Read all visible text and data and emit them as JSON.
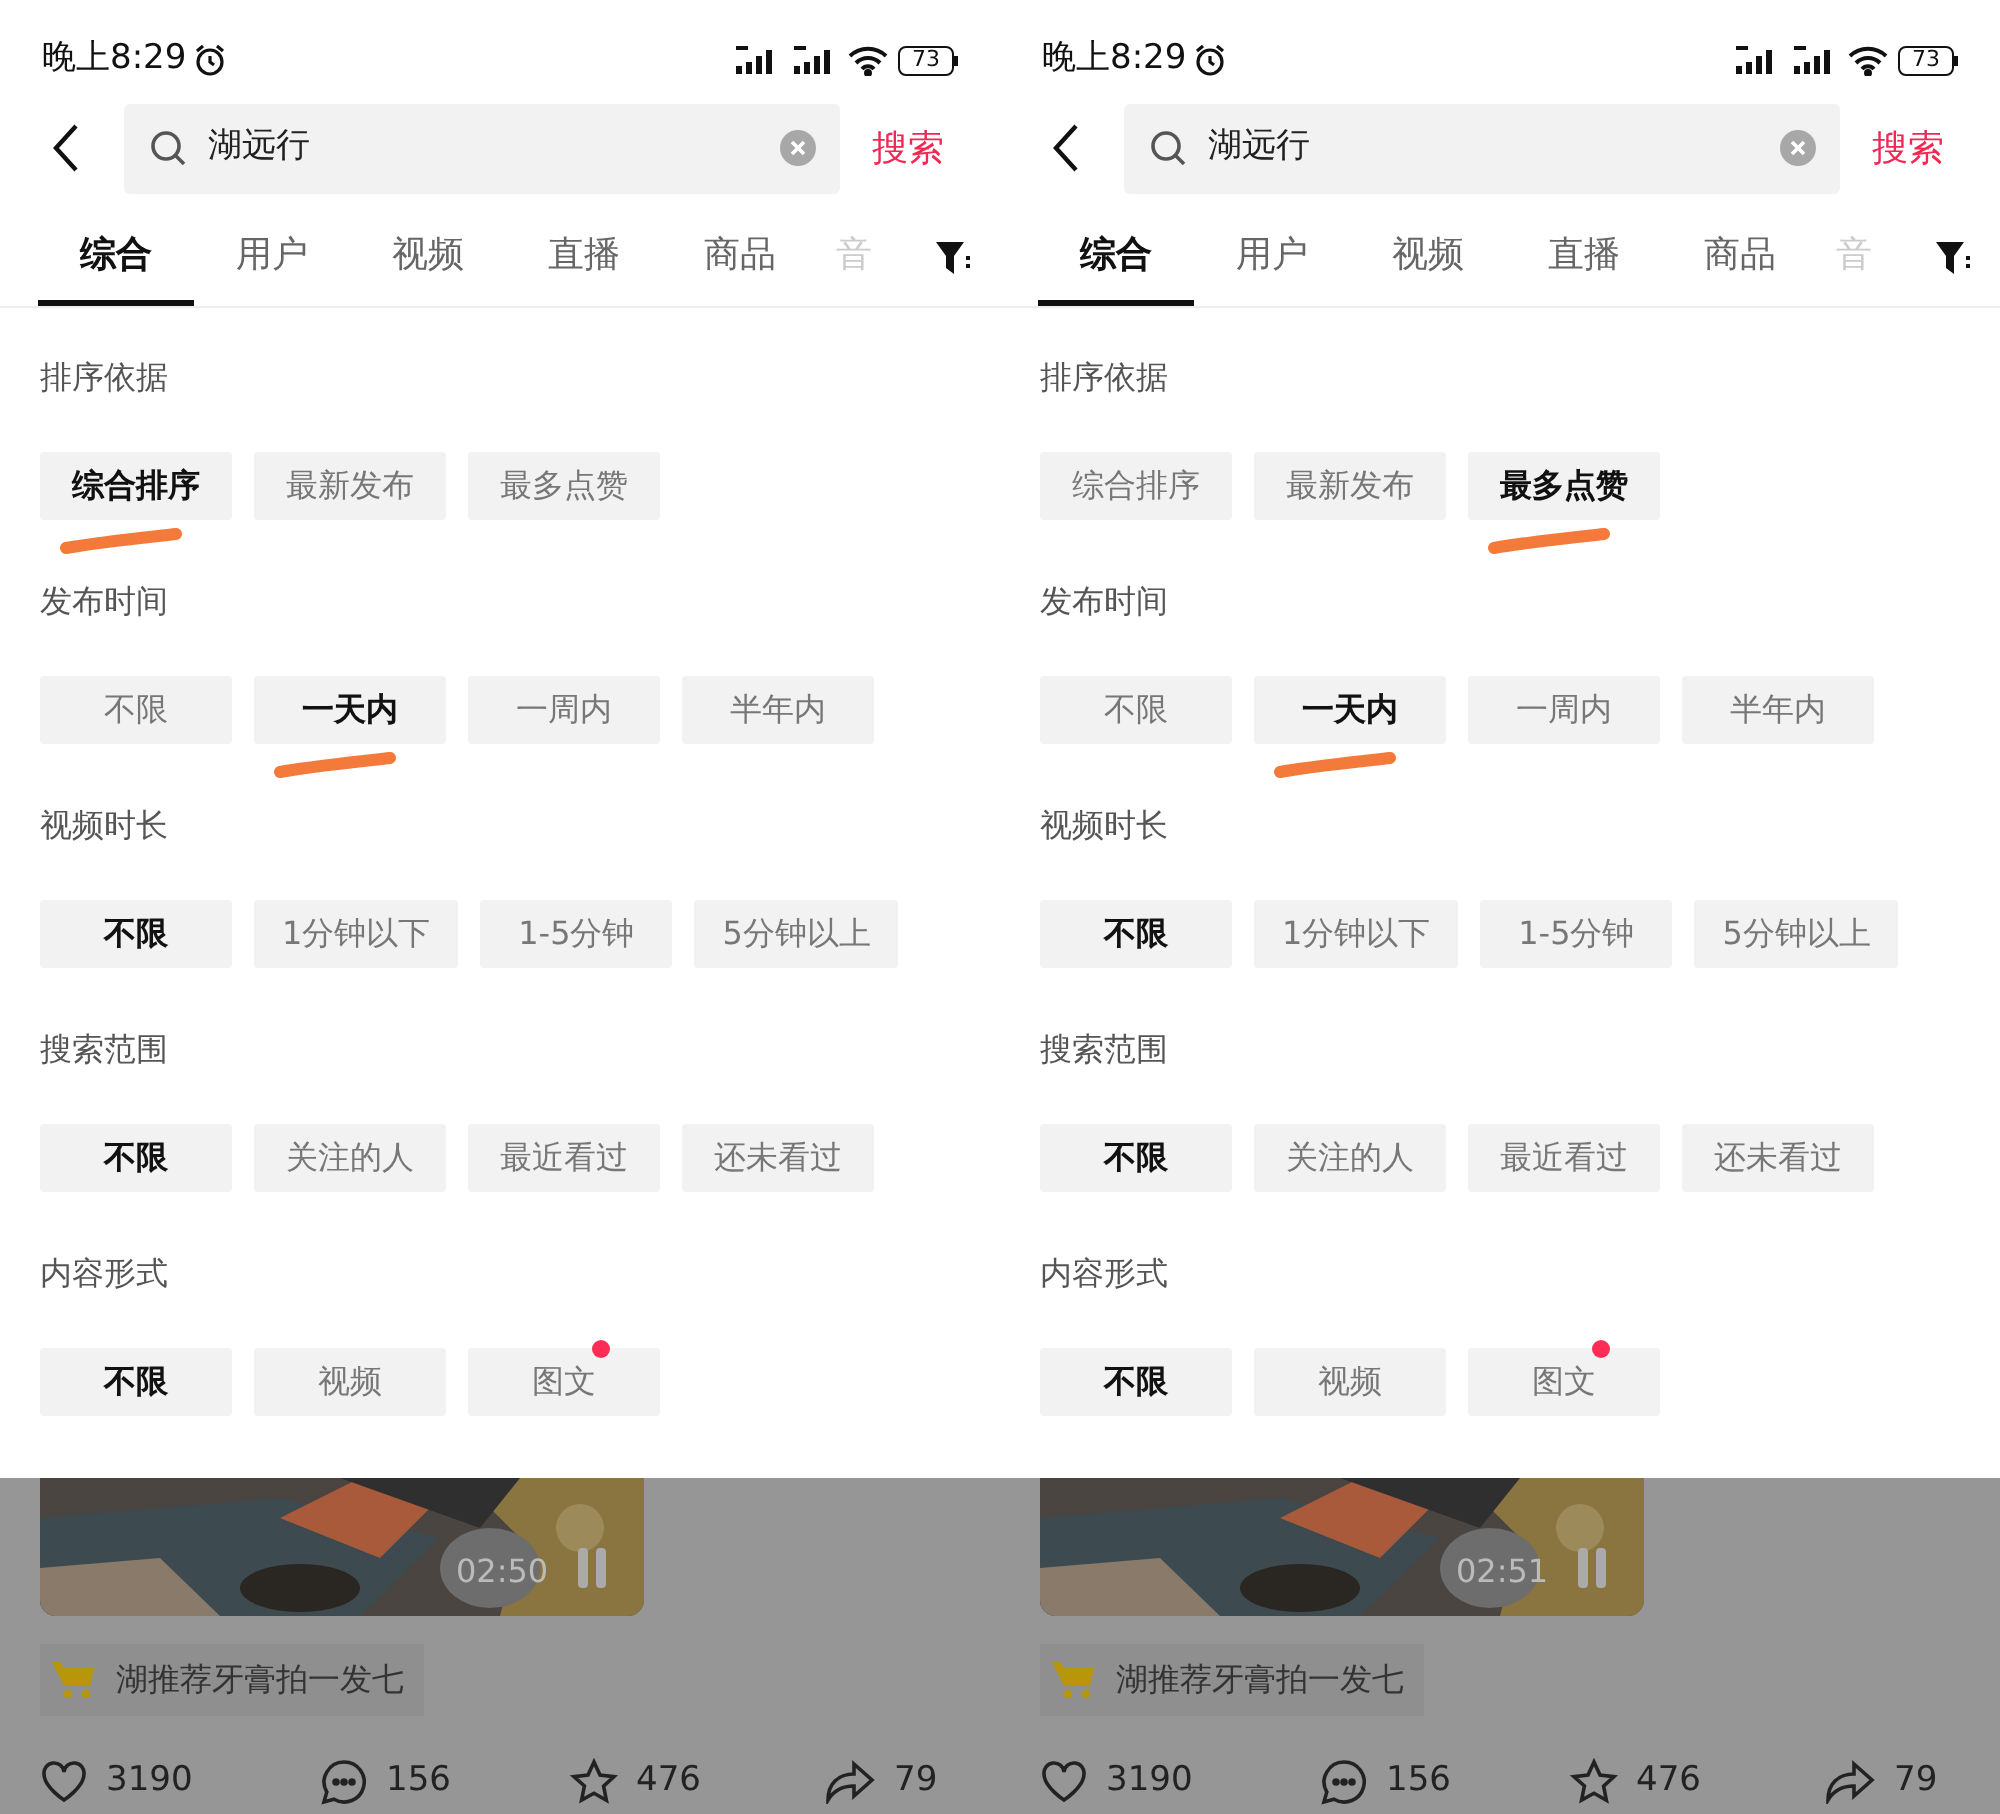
{
  "screens": [
    {
      "status_bar": {
        "time": "晚上8:29",
        "battery": "73"
      },
      "search": {
        "value": "湖远行",
        "button": "搜索"
      },
      "tabs": [
        {
          "label": "综合",
          "selected": true,
          "faded": false
        },
        {
          "label": "用户",
          "selected": false,
          "faded": false
        },
        {
          "label": "视频",
          "selected": false,
          "faded": false
        },
        {
          "label": "直播",
          "selected": false,
          "faded": false
        },
        {
          "label": "商品",
          "selected": false,
          "faded": false
        },
        {
          "label": "音",
          "selected": false,
          "faded": true
        }
      ],
      "filters": [
        {
          "title": "排序依据",
          "options": [
            {
              "label": "综合排序",
              "selected": true,
              "marked": true,
              "dot": false
            },
            {
              "label": "最新发布",
              "selected": false,
              "marked": false,
              "dot": false
            },
            {
              "label": "最多点赞",
              "selected": false,
              "marked": false,
              "dot": false
            }
          ]
        },
        {
          "title": "发布时间",
          "options": [
            {
              "label": "不限",
              "selected": false,
              "marked": false,
              "dot": false
            },
            {
              "label": "一天内",
              "selected": true,
              "marked": true,
              "dot": false
            },
            {
              "label": "一周内",
              "selected": false,
              "marked": false,
              "dot": false
            },
            {
              "label": "半年内",
              "selected": false,
              "marked": false,
              "dot": false
            }
          ]
        },
        {
          "title": "视频时长",
          "options": [
            {
              "label": "不限",
              "selected": true,
              "marked": false,
              "dot": false
            },
            {
              "label": "1分钟以下",
              "selected": false,
              "marked": false,
              "dot": false
            },
            {
              "label": "1-5分钟",
              "selected": false,
              "marked": false,
              "dot": false
            },
            {
              "label": "5分钟以上",
              "selected": false,
              "marked": false,
              "dot": false
            }
          ]
        },
        {
          "title": "搜索范围",
          "options": [
            {
              "label": "不限",
              "selected": true,
              "marked": false,
              "dot": false
            },
            {
              "label": "关注的人",
              "selected": false,
              "marked": false,
              "dot": false
            },
            {
              "label": "最近看过",
              "selected": false,
              "marked": false,
              "dot": false
            },
            {
              "label": "还未看过",
              "selected": false,
              "marked": false,
              "dot": false
            }
          ]
        },
        {
          "title": "内容形式",
          "options": [
            {
              "label": "不限",
              "selected": true,
              "marked": false,
              "dot": false
            },
            {
              "label": "视频",
              "selected": false,
              "marked": false,
              "dot": false
            },
            {
              "label": "图文",
              "selected": false,
              "marked": false,
              "dot": true
            }
          ]
        }
      ],
      "result": {
        "duration": "02:50",
        "product": "湖推荐牙膏拍一发七",
        "likes": "3190",
        "comments": "156",
        "favorites": "476",
        "shares": "79"
      }
    },
    {
      "status_bar": {
        "time": "晚上8:29",
        "battery": "73"
      },
      "search": {
        "value": "湖远行",
        "button": "搜索"
      },
      "tabs": [
        {
          "label": "综合",
          "selected": true,
          "faded": false
        },
        {
          "label": "用户",
          "selected": false,
          "faded": false
        },
        {
          "label": "视频",
          "selected": false,
          "faded": false
        },
        {
          "label": "直播",
          "selected": false,
          "faded": false
        },
        {
          "label": "商品",
          "selected": false,
          "faded": false
        },
        {
          "label": "音",
          "selected": false,
          "faded": true
        }
      ],
      "filters": [
        {
          "title": "排序依据",
          "options": [
            {
              "label": "综合排序",
              "selected": false,
              "marked": false,
              "dot": false
            },
            {
              "label": "最新发布",
              "selected": false,
              "marked": false,
              "dot": false
            },
            {
              "label": "最多点赞",
              "selected": true,
              "marked": true,
              "dot": false
            }
          ]
        },
        {
          "title": "发布时间",
          "options": [
            {
              "label": "不限",
              "selected": false,
              "marked": false,
              "dot": false
            },
            {
              "label": "一天内",
              "selected": true,
              "marked": true,
              "dot": false
            },
            {
              "label": "一周内",
              "selected": false,
              "marked": false,
              "dot": false
            },
            {
              "label": "半年内",
              "selected": false,
              "marked": false,
              "dot": false
            }
          ]
        },
        {
          "title": "视频时长",
          "options": [
            {
              "label": "不限",
              "selected": true,
              "marked": false,
              "dot": false
            },
            {
              "label": "1分钟以下",
              "selected": false,
              "marked": false,
              "dot": false
            },
            {
              "label": "1-5分钟",
              "selected": false,
              "marked": false,
              "dot": false
            },
            {
              "label": "5分钟以上",
              "selected": false,
              "marked": false,
              "dot": false
            }
          ]
        },
        {
          "title": "搜索范围",
          "options": [
            {
              "label": "不限",
              "selected": true,
              "marked": false,
              "dot": false
            },
            {
              "label": "关注的人",
              "selected": false,
              "marked": false,
              "dot": false
            },
            {
              "label": "最近看过",
              "selected": false,
              "marked": false,
              "dot": false
            },
            {
              "label": "还未看过",
              "selected": false,
              "marked": false,
              "dot": false
            }
          ]
        },
        {
          "title": "内容形式",
          "options": [
            {
              "label": "不限",
              "selected": true,
              "marked": false,
              "dot": false
            },
            {
              "label": "视频",
              "selected": false,
              "marked": false,
              "dot": false
            },
            {
              "label": "图文",
              "selected": false,
              "marked": false,
              "dot": true
            }
          ]
        }
      ],
      "result": {
        "duration": "02:51",
        "product": "湖推荐牙膏拍一发七",
        "likes": "3190",
        "comments": "156",
        "favorites": "476",
        "shares": "79"
      }
    }
  ]
}
